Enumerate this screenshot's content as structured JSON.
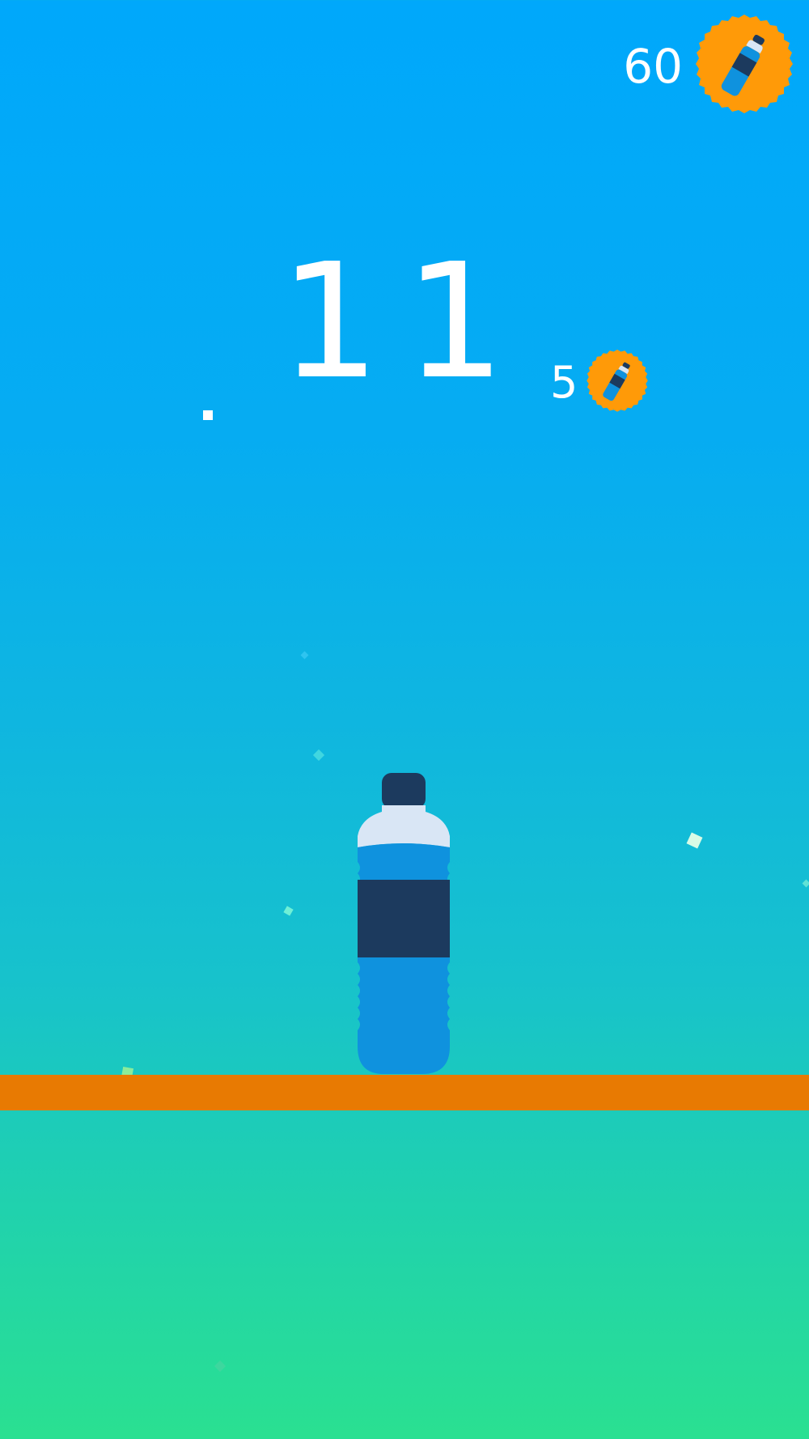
{
  "hud": {
    "coin_total": "60",
    "coin_icon": "bottle-coin-icon"
  },
  "score": {
    "value": "11"
  },
  "bonus": {
    "value": "5",
    "icon": "bottle-coin-icon"
  },
  "colors": {
    "sky_top": "#00a8fb",
    "sky_bottom": "#2ae091",
    "platform": "#e87a02",
    "coin": "#ff9a08",
    "bottle_body": "#0f92de",
    "bottle_label": "#1c3a5e",
    "bottle_cap": "#1c3a5e",
    "bottle_neck": "#d9e6f5"
  },
  "scene": {
    "object": "water-bottle",
    "platform": "orange-platform"
  }
}
